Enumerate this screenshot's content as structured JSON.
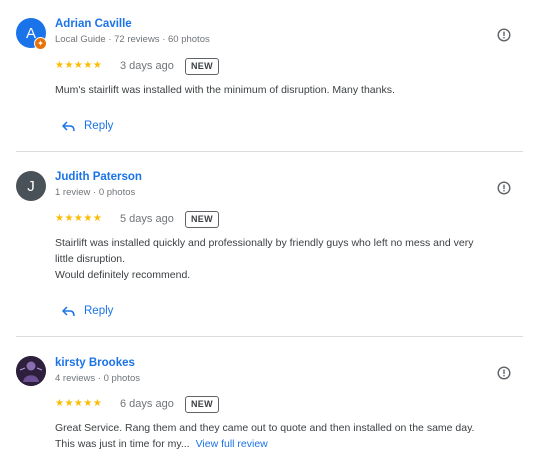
{
  "colors": {
    "link": "#1a73e8",
    "star": "#fbbc04",
    "guide_badge": "#e8710a"
  },
  "reviews": [
    {
      "avatar_letter": "A",
      "avatar_color": "#1a73e8",
      "local_guide_badge_icon": "local-guide-badge-icon",
      "name": "Adrian Caville",
      "meta": "Local Guide · 72 reviews · 60 photos",
      "stars": "★★★★★",
      "rating": 5,
      "date": "3 days ago",
      "badge": "NEW",
      "text": "Mum's stairlift was installed with the minimum of disruption. Many thanks.",
      "reply_label": "Reply"
    },
    {
      "avatar_letter": "J",
      "avatar_color": "#4a5259",
      "name": "Judith Paterson",
      "meta": "1 review · 0 photos",
      "stars": "★★★★★",
      "rating": 5,
      "date": "5 days ago",
      "badge": "NEW",
      "text_lines": [
        "Stairlift was installed quickly and professionally by friendly guys who left no mess and very",
        "little disruption.",
        "Would definitely recommend."
      ],
      "reply_label": "Reply"
    },
    {
      "avatar_icon": "profile-photo-avatar",
      "name": "kirsty Brookes",
      "meta": "4 reviews · 0 photos",
      "stars": "★★★★★",
      "rating": 5,
      "date": "6 days ago",
      "badge": "NEW",
      "text_lines": [
        "Great Service. Rang them and they came out to quote and then installed on the same day.",
        "This was just in time for my..."
      ],
      "view_full": "View full review"
    }
  ]
}
